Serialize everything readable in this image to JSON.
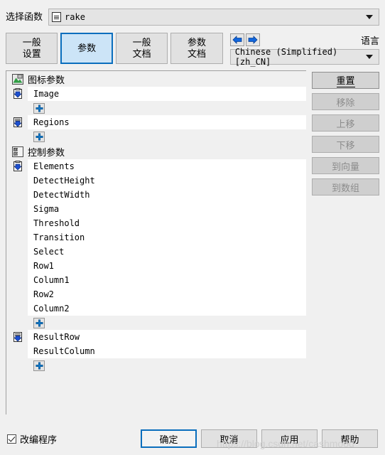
{
  "header": {
    "function_label": "选择函数",
    "function_value": "rake",
    "function_icon": "document-list-icon"
  },
  "tabs": [
    {
      "id": "general-settings",
      "line1": "一般",
      "line2": "设置",
      "selected": false
    },
    {
      "id": "parameters",
      "line1": "参数",
      "line2": "",
      "selected": true
    },
    {
      "id": "general-doc",
      "line1": "一般",
      "line2": "文档",
      "selected": false
    },
    {
      "id": "parameter-doc",
      "line1": "参数",
      "line2": "文档",
      "selected": false
    }
  ],
  "language": {
    "label": "语言",
    "value": "Chinese (Simplified) [zh_CN]",
    "back_icon": "arrow-left-icon",
    "forward_icon": "arrow-right-icon"
  },
  "groups": [
    {
      "id": "icon-parameters",
      "header": "图标参数",
      "header_icon": "image-parameter-icon",
      "blocks": [
        {
          "icon": "input-object-icon",
          "rows": [
            "Image"
          ],
          "add_label": "+"
        },
        {
          "icon": "input-region-icon",
          "rows": [
            "Regions"
          ],
          "add_label": "+"
        }
      ]
    },
    {
      "id": "control-parameters",
      "header": "控制参数",
      "header_icon": "control-parameter-icon",
      "blocks": [
        {
          "icon": "input-control-icon",
          "rows": [
            "Elements",
            "DetectHeight",
            "DetectWidth",
            "Sigma",
            "Threshold",
            "Transition",
            "Select",
            "Row1",
            "Column1",
            "Row2",
            "Column2"
          ],
          "add_label": "+"
        },
        {
          "icon": "output-control-icon",
          "rows": [
            "ResultRow",
            "ResultColumn"
          ],
          "add_label": "+"
        }
      ]
    }
  ],
  "side_buttons": [
    {
      "id": "reset",
      "label": "重置",
      "enabled": true
    },
    {
      "id": "remove",
      "label": "移除",
      "enabled": false
    },
    {
      "id": "move-up",
      "label": "上移",
      "enabled": false
    },
    {
      "id": "move-down",
      "label": "下移",
      "enabled": false
    },
    {
      "id": "to-vector",
      "label": "到向量",
      "enabled": false
    },
    {
      "id": "to-array",
      "label": "到数组",
      "enabled": false
    }
  ],
  "footer": {
    "checkbox_label": "改编程序",
    "checkbox_checked": true,
    "buttons": [
      {
        "id": "ok",
        "label": "确定",
        "default": true
      },
      {
        "id": "cancel",
        "label": "取消",
        "default": false
      },
      {
        "id": "apply",
        "label": "应用",
        "default": false
      },
      {
        "id": "help",
        "label": "帮助",
        "default": false
      }
    ]
  },
  "watermark": "https://blog.csdn.net/cashmood"
}
